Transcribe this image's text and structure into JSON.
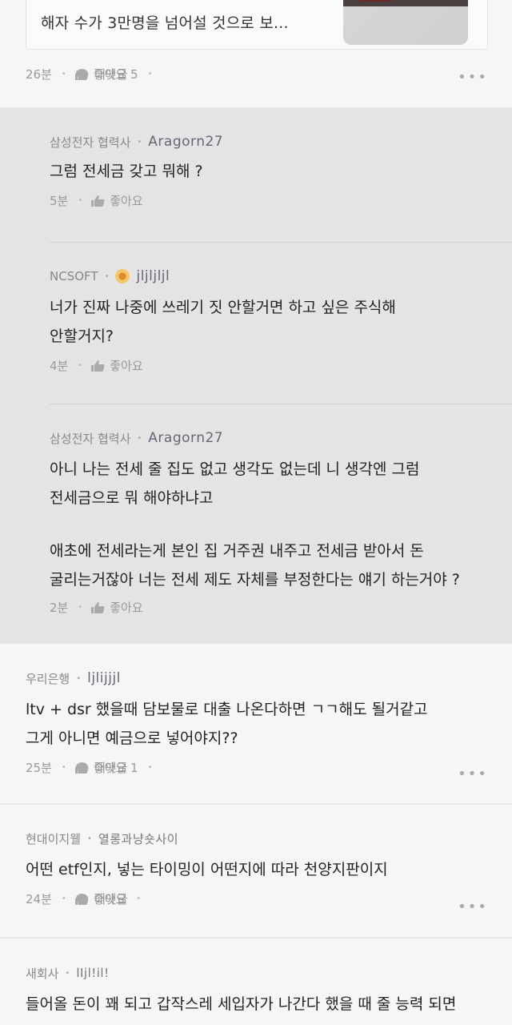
{
  "article": {
    "text": "해자 수가 3만명을 넘어설 것으로 보...",
    "time": "26분",
    "like_label": "좋아요 5",
    "reply_label": "대댓글"
  },
  "replies": [
    {
      "company": "삼성전자 협력사",
      "nick": "Aragorn27",
      "lines": [
        "그럼 전세금 갖고 뭐해 ?"
      ],
      "time": "5분",
      "like_label": "좋아요"
    },
    {
      "company": "NCSOFT",
      "nick": "jljljljl",
      "lines": [
        "너가 진짜 나중에 쓰레기 짓 안할거면 하고 싶은 주식해",
        "안할거지?"
      ],
      "time": "4분",
      "like_label": "좋아요"
    },
    {
      "company": "삼성전자 협력사",
      "nick": "Aragorn27",
      "lines": [
        "아니 나는 전세 줄 집도 없고 생각도 없는데 니 생각엔 그럼",
        "전세금으로 뭐 해야하냐고",
        "",
        "애초에 전세라는게 본인 집 거주권 내주고 전세금 받아서 돈",
        "굴리는거잖아 너는 전세 제도 자체를 부정한다는 얘기 하는거야 ?"
      ],
      "time": "2분",
      "like_label": "좋아요"
    }
  ],
  "comments": [
    {
      "company": "우리은행",
      "nick": "ljlijjjl",
      "lines": [
        "ltv + dsr 했을때 담보물로 대출 나온다하면 ㄱㄱ해도 될거같고",
        "그게 아니면 예금으로 넣어야지??"
      ],
      "time": "25분",
      "like_label": "좋아요 1",
      "reply_label": "대댓글"
    },
    {
      "company": "현대이지웰",
      "nick": "열롱과냥숏사이",
      "lines": [
        "어떤 etf인지, 넣는 타이밍이 어떤지에 따라 천양지판이지"
      ],
      "time": "24분",
      "like_label": "좋아요",
      "reply_label": "대댓글"
    },
    {
      "company": "새회사",
      "nick": "lIjl!il!",
      "lines": [
        "들어올 돈이 꽤 되고 갑작스레 세입자가 나간다 했을 때 줄 능력 되면"
      ],
      "time": "",
      "like_label": "",
      "reply_label": ""
    }
  ],
  "icons": {
    "like": "thumbs-up-icon",
    "reply": "speech-bubble-icon",
    "more": "more-dots-icon",
    "badge": "ncsoft-badge-icon"
  },
  "colors": {
    "thread_bg": "#e4e4e4",
    "page_bg": "#f6f6f6",
    "meta": "#999999",
    "nick": "#667788"
  }
}
